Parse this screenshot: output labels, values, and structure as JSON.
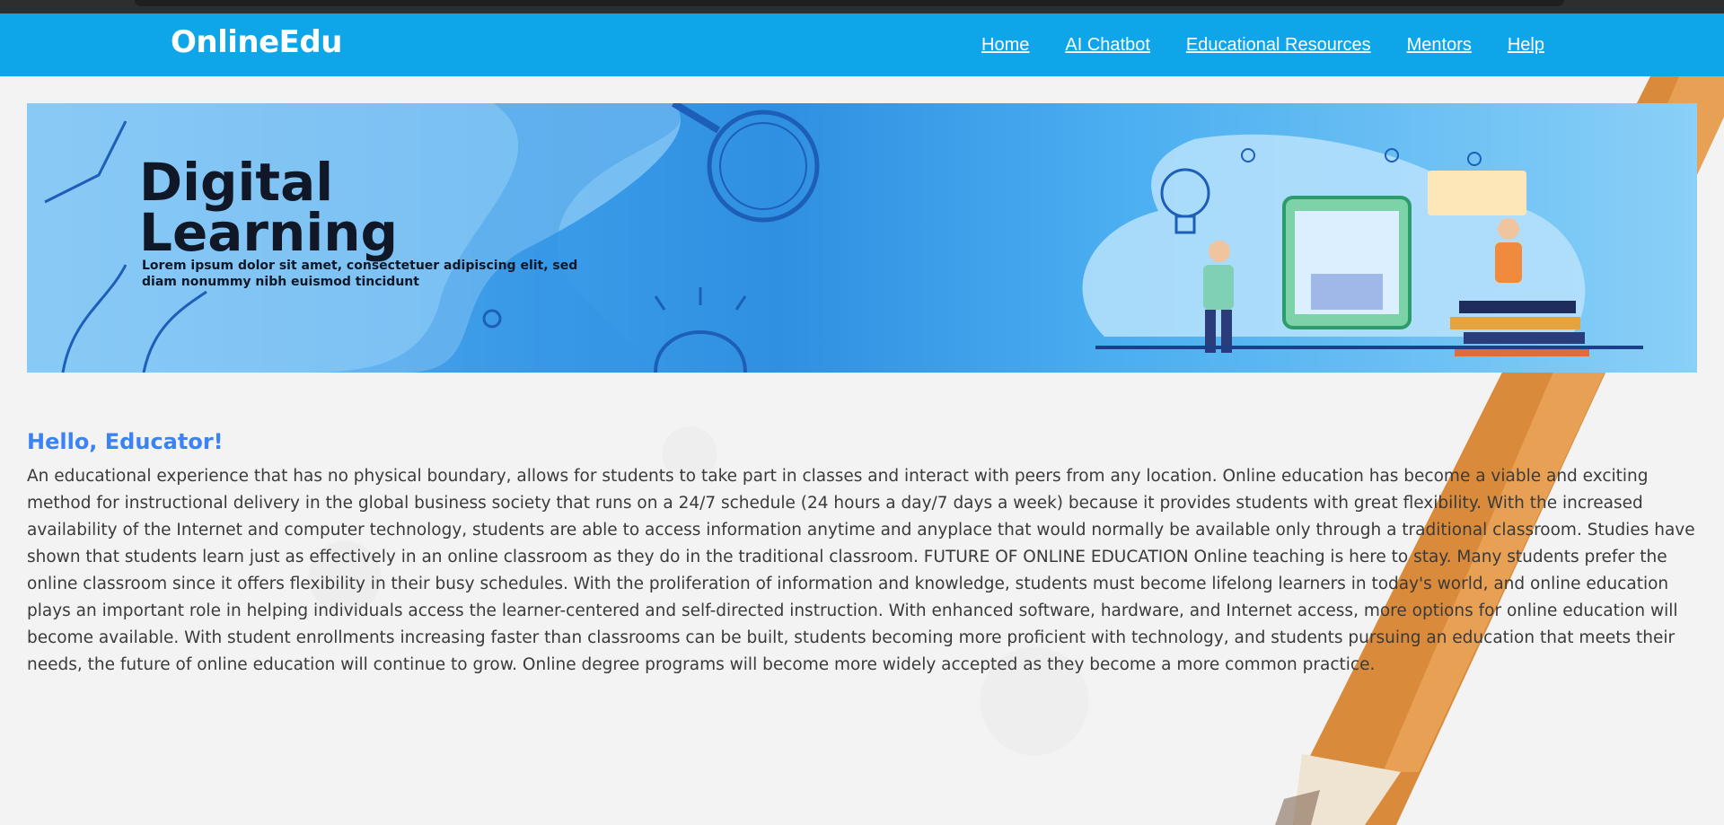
{
  "brand": {
    "name": "OnlineEdu"
  },
  "nav": {
    "items": [
      {
        "label": "Home"
      },
      {
        "label": "AI Chatbot"
      },
      {
        "label": "Educational Resources"
      },
      {
        "label": "Mentors"
      },
      {
        "label": "Help"
      }
    ]
  },
  "banner": {
    "title_line1": "Digital",
    "title_line2": "Learning",
    "subtitle_line1": "Lorem ipsum dolor sit amet, consectetuer adipiscing elit, sed",
    "subtitle_line2": "diam nonummy nibh euismod tincidunt"
  },
  "main": {
    "greeting": "Hello, Educator!",
    "paragraph": "An educational experience that has no physical boundary, allows for students to take part in classes and interact with peers from any location. Online education has become a viable and exciting method for instructional delivery in the global business society that runs on a 24/7 schedule (24 hours a day/7 days a week) because it provides students with great flexibility. With the increased availability of the Internet and computer technology, students are able to access information anytime and anyplace that would normally be available only through a traditional classroom. Studies have shown that students learn just as effectively in an online classroom as they do in the traditional classroom. FUTURE OF ONLINE EDUCATION Online teaching is here to stay. Many students prefer the online classroom since it offers flexibility in their busy schedules. With the proliferation of information and knowledge, students must become lifelong learners in today's world, and online education plays an important role in helping individuals access the learner-centered and self-directed instruction. With enhanced software, hardware, and Internet access, more options for online education will become available. With student enrollments increasing faster than classrooms can be built, students becoming more proficient with technology, and students pursuing an education that meets their needs, the future of online education will continue to grow. Online degree programs will become more widely accepted as they become a more common practice."
  },
  "colors": {
    "navbar": "#0ea5e9",
    "greeting": "#3b82f6",
    "pencil": "#d98a3a"
  }
}
